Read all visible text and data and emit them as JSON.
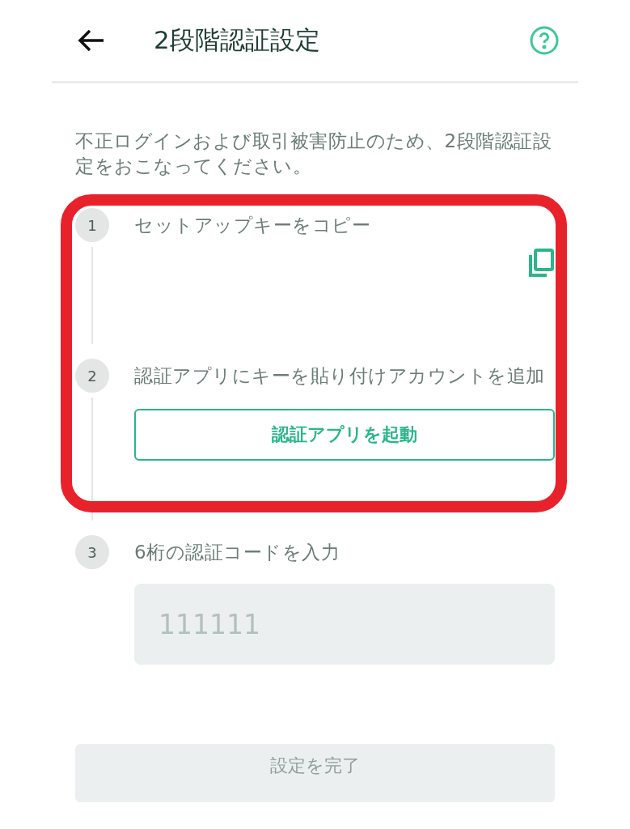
{
  "header": {
    "title": "2段階認証設定"
  },
  "intro": "不正ログインおよび取引被害防止のため、2段階認証設定をおこなってください。",
  "steps": [
    {
      "number": "1",
      "label": "セットアップキーをコピー",
      "kind": "copy"
    },
    {
      "number": "2",
      "label": "認証アプリにキーを貼り付けアカウントを追加",
      "kind": "button",
      "button": "認証アプリを起動"
    },
    {
      "number": "3",
      "label": "6桁の認証コードを入力",
      "kind": "input",
      "placeholder": "111111"
    }
  ],
  "complete_button": {
    "label": "設定を完了",
    "disabled": true
  }
}
